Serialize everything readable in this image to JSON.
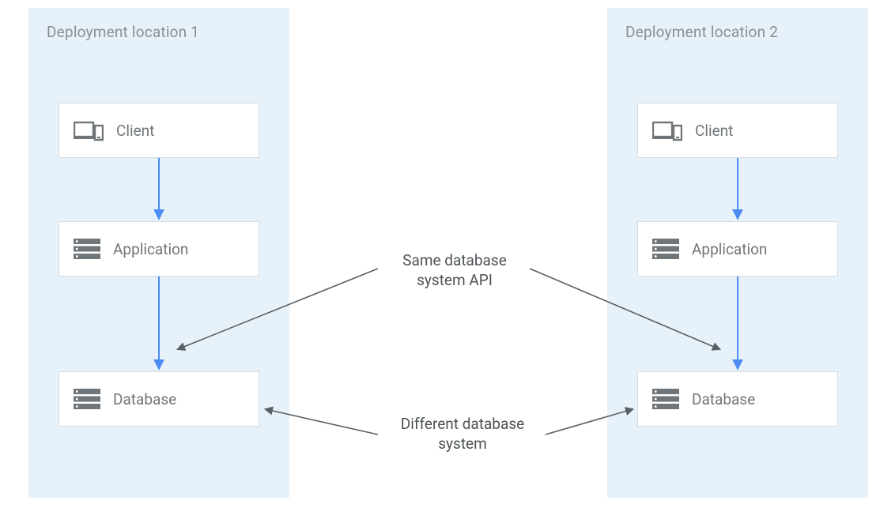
{
  "regions": {
    "loc1": {
      "title": "Deployment location 1"
    },
    "loc2": {
      "title": "Deployment location 2"
    }
  },
  "nodes": {
    "client1": {
      "label": "Client"
    },
    "app1": {
      "label": "Application"
    },
    "db1": {
      "label": "Database"
    },
    "client2": {
      "label": "Client"
    },
    "app2": {
      "label": "Application"
    },
    "db2": {
      "label": "Database"
    }
  },
  "annotations": {
    "same_api": "Same database\nsystem API",
    "diff_db": "Different database\nsystem"
  },
  "colors": {
    "region_bg": "#e7f1fa",
    "node_border": "#d7dbde",
    "text_muted": "#707579",
    "arrow_blue": "#4b8cf5",
    "arrow_dark": "#5a5f63"
  }
}
